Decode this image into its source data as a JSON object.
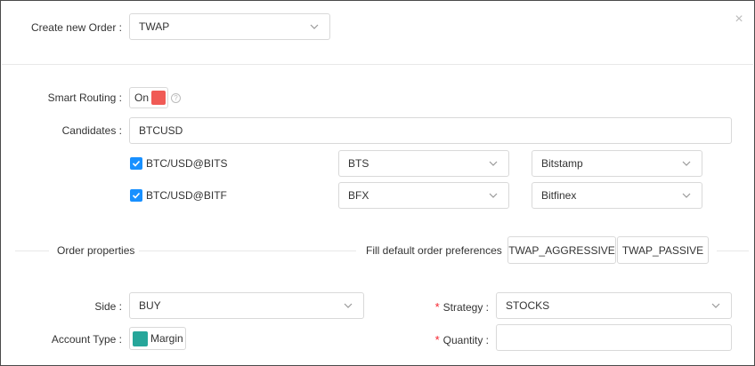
{
  "header": {
    "create_label": "Create new Order :",
    "order_type": "TWAP",
    "close_symbol": "×"
  },
  "routing": {
    "smart_routing_label": "Smart Routing :",
    "toggle_text": "On",
    "help_symbol": "?",
    "candidates_label": "Candidates :",
    "candidates_value": "BTCUSD",
    "rows": [
      {
        "label": "BTC/USD@BITS",
        "code": "BTS",
        "exchange": "Bitstamp",
        "checked": true
      },
      {
        "label": "BTC/USD@BITF",
        "code": "BFX",
        "exchange": "Bitfinex",
        "checked": true
      }
    ]
  },
  "section": {
    "order_properties": "Order properties",
    "fill_defaults": "Fill default order preferences",
    "btn_aggressive": "TWAP_AGGRESSIVE",
    "btn_passive": "TWAP_PASSIVE"
  },
  "order": {
    "side_label": "Side :",
    "side_value": "BUY",
    "account_type_label": "Account Type :",
    "account_type_value": "Margin",
    "strategy_label": "Strategy :",
    "strategy_value": "STOCKS",
    "quantity_label": "Quantity :",
    "quantity_value": "",
    "required_mark": "*"
  },
  "colors": {
    "toggle_on": "#f05a55",
    "checkbox": "#1890ff",
    "margin_swatch": "#26a69a",
    "required": "#f5222d"
  }
}
